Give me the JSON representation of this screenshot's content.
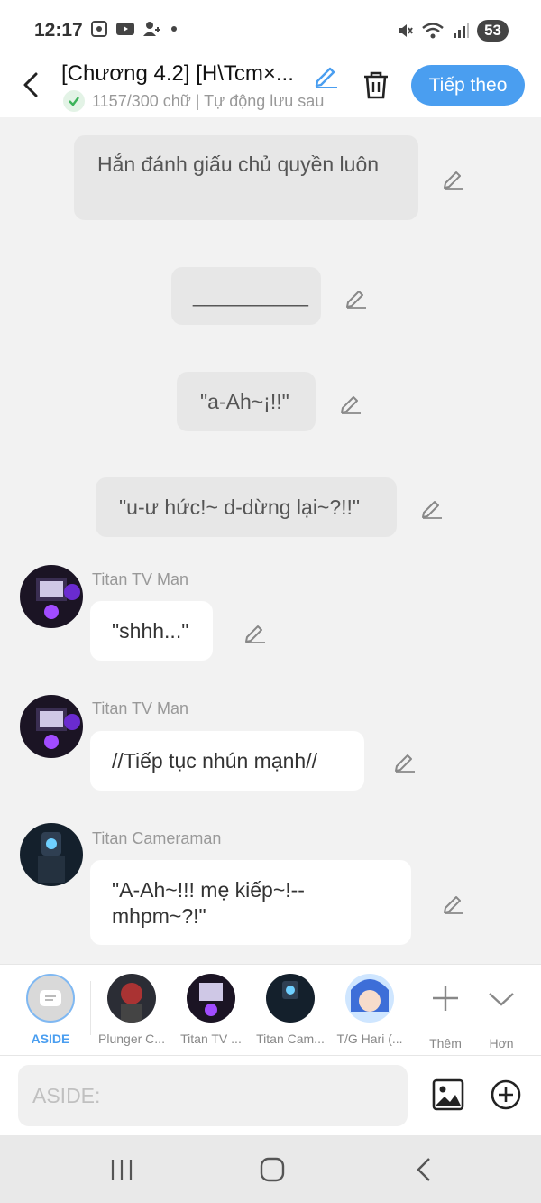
{
  "status": {
    "time": "12:17",
    "battery": "53",
    "icons": [
      "screenshot-icon",
      "youtube-icon",
      "add-person-icon",
      "dot-icon",
      "mute-icon",
      "wifi-icon",
      "signal-icon"
    ]
  },
  "header": {
    "title": "[Chương 4.2] [H\\Tcm×...",
    "subtitle": "1157/300 chữ | Tự động lưu sau",
    "next_label": "Tiếp theo"
  },
  "messages": [
    {
      "text": "Hắn đánh giấu chủ quyền luôn"
    },
    {
      "text": "__________"
    },
    {
      "text": "\"a-Ah~¡!!\""
    },
    {
      "text": "\"u-ư hức!~ d-dừng lại~?!!\""
    },
    {
      "speaker": "Titan TV Man",
      "text": "\"shhh...\""
    },
    {
      "speaker": "Titan TV Man",
      "text": "//Tiếp tục nhún mạnh//"
    },
    {
      "speaker": "Titan Cameraman",
      "text": "\"A-Ah~!!! mẹ kiếp~!--mhpm~?!\""
    }
  ],
  "characters": [
    {
      "label": "ASIDE"
    },
    {
      "label": "Plunger C..."
    },
    {
      "label": "Titan TV ..."
    },
    {
      "label": "Titan Cam..."
    },
    {
      "label": "T/G Hari (..."
    },
    {
      "label": "Thêm"
    },
    {
      "label": "Hơn"
    }
  ],
  "input": {
    "placeholder": "ASIDE:"
  },
  "colors": {
    "accent": "#4a9ef0",
    "aside_label": "#4a9ef0"
  }
}
